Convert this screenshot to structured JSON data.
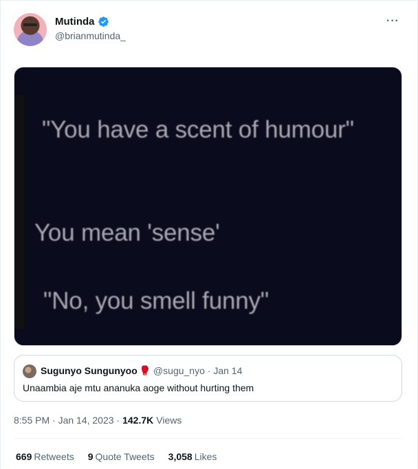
{
  "author": {
    "display_name": "Mutinda",
    "handle": "@brianmutinda_",
    "verified_icon": "verified-badge-icon"
  },
  "more_label": "···",
  "media": {
    "lines": [
      "\"You have a scent of humour\"",
      "You mean 'sense'",
      "\"No, you smell funny\""
    ],
    "background": "#0b0b1e"
  },
  "quote": {
    "display_name": "Sugunyo Sungunyoo",
    "emoji": "🥊",
    "meta": "@sugu_nyo · Jan 14",
    "text": "Unaambia aje mtu ananuka aoge without hurting them"
  },
  "timestamp": {
    "time": "8:55 PM · Jan 14, 2023 ·",
    "views_count": "142.7K",
    "views_label": "Views"
  },
  "stats": [
    {
      "count": "669",
      "label": "Retweets"
    },
    {
      "count": "9",
      "label": "Quote Tweets"
    },
    {
      "count": "3,058",
      "label": "Likes"
    }
  ],
  "colors": {
    "accent": "#1d9bf0",
    "secondary_text": "#536471"
  }
}
